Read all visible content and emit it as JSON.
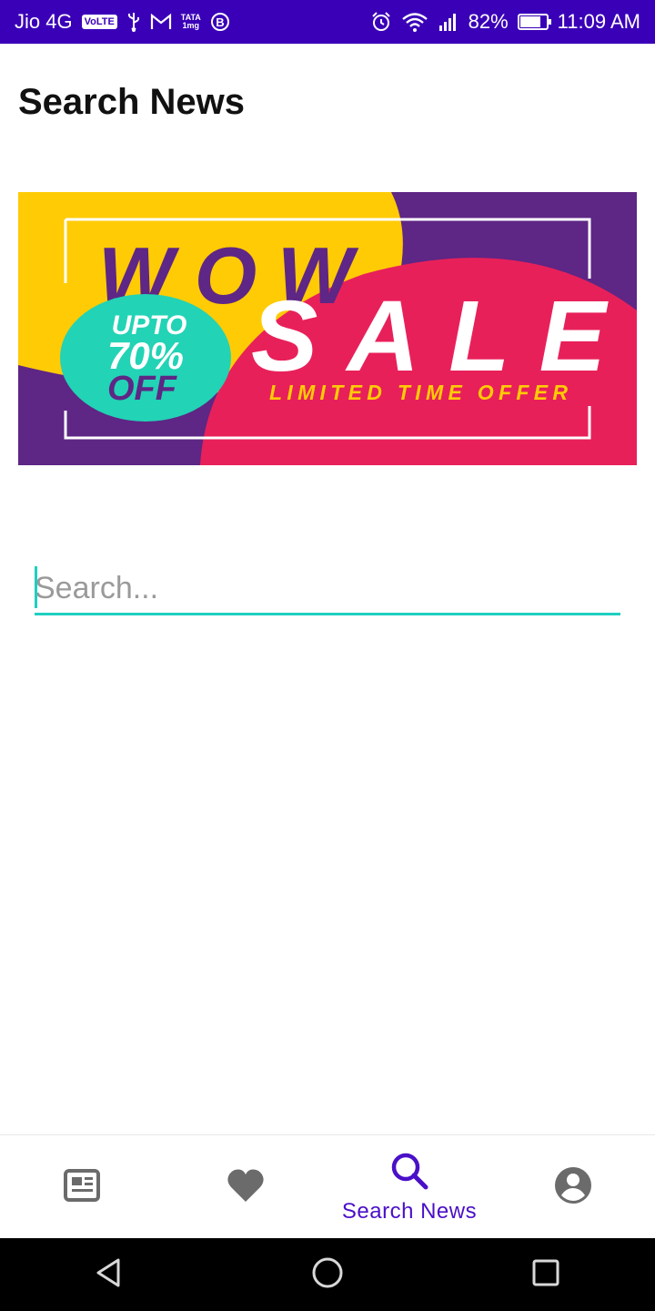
{
  "status_bar": {
    "carrier": "Jio 4G",
    "volte": "VoLTE",
    "tata_line1": "TATA",
    "tata_line2": "1mg",
    "battery_percent_text": "82%",
    "battery_level": 0.82,
    "time": "11:09 AM",
    "icons": [
      "usb-icon",
      "gmail-icon",
      "b-circle-icon",
      "alarm-icon",
      "wifi-icon",
      "signal-icon",
      "battery-icon"
    ]
  },
  "page": {
    "title": "Search News"
  },
  "banner": {
    "line1": "WOW",
    "line2": "SALE",
    "badge_line1": "UPTO",
    "badge_line2": "70%",
    "badge_line3": "OFF",
    "tagline": "LIMITED TIME OFFER",
    "colors": {
      "purple": "#5e2685",
      "yellow": "#ffcb05",
      "pink": "#e8205a",
      "teal": "#22d3b5",
      "white": "#ffffff"
    }
  },
  "search": {
    "placeholder": "Search...",
    "value": "",
    "accent": "#1fcfc1"
  },
  "bottom_nav": {
    "items": [
      {
        "icon": "newspaper-icon",
        "label": "",
        "selected": false
      },
      {
        "icon": "heart-icon",
        "label": "",
        "selected": false
      },
      {
        "icon": "search-icon",
        "label": "Search News",
        "selected": true
      },
      {
        "icon": "account-icon",
        "label": "",
        "selected": false
      }
    ],
    "active_color": "#4a10c8",
    "inactive_color": "#6b6b6b"
  },
  "system_nav": {
    "buttons": [
      "back-icon",
      "home-icon",
      "recents-icon"
    ]
  }
}
